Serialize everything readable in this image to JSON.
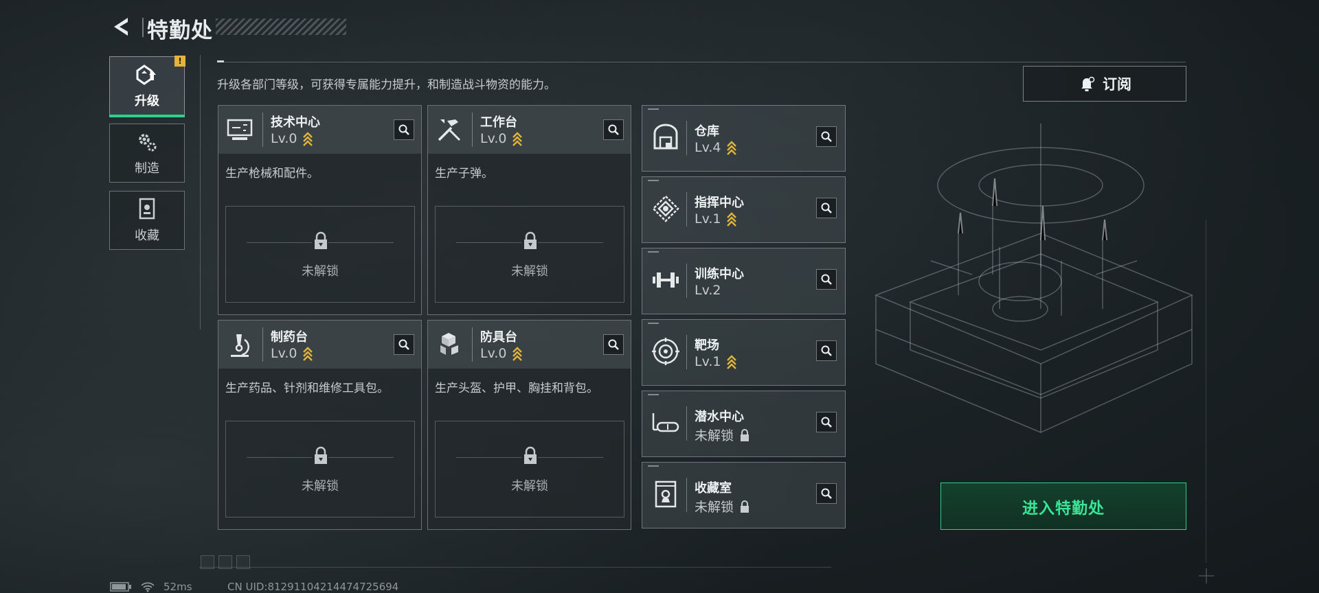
{
  "header": {
    "title": "特勤处"
  },
  "nav": [
    {
      "label": "升级",
      "active": true,
      "badge": "!"
    },
    {
      "label": "制造",
      "active": false
    },
    {
      "label": "收藏",
      "active": false
    }
  ],
  "description": "升级各部门等级，可获得专属能力提升，和制造战斗物资的能力。",
  "subscribe_label": "订阅",
  "big_cards": [
    {
      "name": "技术中心",
      "level": "Lv.0",
      "desc": "生产枪械和配件。",
      "locked": "未解锁"
    },
    {
      "name": "工作台",
      "level": "Lv.0",
      "desc": "生产子弹。",
      "locked": "未解锁"
    },
    {
      "name": "制药台",
      "level": "Lv.0",
      "desc": "生产药品、针剂和维修工具包。",
      "locked": "未解锁"
    },
    {
      "name": "防具台",
      "level": "Lv.0",
      "desc": "生产头盔、护甲、胸挂和背包。",
      "locked": "未解锁"
    }
  ],
  "small_cards": [
    {
      "name": "仓库",
      "level": "Lv.4",
      "upgradable": true
    },
    {
      "name": "指挥中心",
      "level": "Lv.1",
      "upgradable": true
    },
    {
      "name": "训练中心",
      "level": "Lv.2",
      "upgradable": false
    },
    {
      "name": "靶场",
      "level": "Lv.1",
      "upgradable": true
    },
    {
      "name": "潜水中心",
      "level": "未解锁",
      "upgradable": false,
      "locked": true
    },
    {
      "name": "收藏室",
      "level": "未解锁",
      "upgradable": false,
      "locked": true
    }
  ],
  "enter_label": "进入特勤处",
  "status": {
    "ping": "52ms",
    "uid": "CN UID:81291104214474725694"
  },
  "colors": {
    "accent_green": "#2fd08a",
    "upgrade_gold": "#e3b43a",
    "badge_yellow": "#e3b43a"
  }
}
